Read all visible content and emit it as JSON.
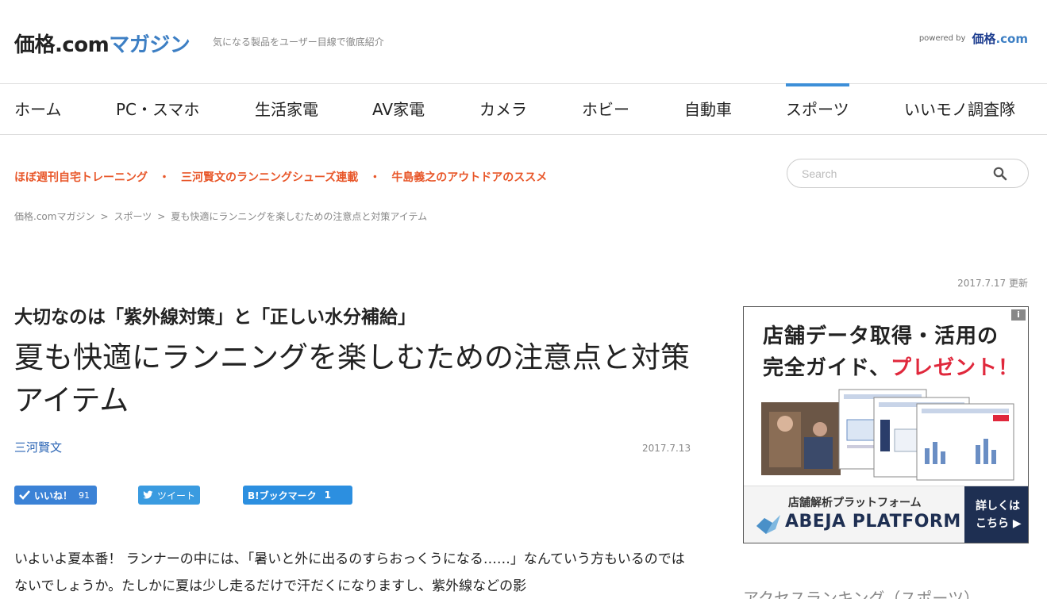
{
  "header": {
    "logo_part1": "価格.com",
    "logo_part2": "マガジン",
    "tagline": "気になる製品をユーザー目線で徹底紹介",
    "powered_by": "powered by",
    "powered_logo_part1": "価格",
    "powered_logo_part2": ".com"
  },
  "nav": {
    "items": [
      {
        "label": "ホーム"
      },
      {
        "label": "PC・スマホ"
      },
      {
        "label": "生活家電"
      },
      {
        "label": "AV家電"
      },
      {
        "label": "カメラ"
      },
      {
        "label": "ホビー"
      },
      {
        "label": "自動車"
      },
      {
        "label": "スポーツ",
        "active": true
      },
      {
        "label": "いいモノ調査隊"
      }
    ]
  },
  "subnav": {
    "links": [
      "ほぼ週刊自宅トレーニング",
      "三河賢文のランニングシューズ連載",
      "牛島義之のアウトドアのススメ"
    ],
    "separator": "・"
  },
  "search": {
    "placeholder": "Search"
  },
  "breadcrumb": {
    "items": [
      "価格.comマガジン",
      "スポーツ",
      "夏も快適にランニングを楽しむための注意点と対策アイテム"
    ],
    "separator": ">"
  },
  "updated": "2017.7.17 更新",
  "article": {
    "subtitle": "大切なのは「紫外線対策」と「正しい水分補給」",
    "title": "夏も快適にランニングを楽しむための注意点と対策アイテム",
    "author": "三河賢文",
    "date": "2017.7.13",
    "body": "いよいよ夏本番！ ランナーの中には、「暑いと外に出るのすらおっくうになる……」なんていう方もいるのではないでしょうか。たしかに夏は少し走るだけで汗だくになりますし、紫外線などの影"
  },
  "social": {
    "like_label": "いいね！",
    "like_count": "91",
    "tweet_label": "ツイート",
    "hatena_label": "B!ブックマーク",
    "hatena_count": "1"
  },
  "ad": {
    "info": "i",
    "headline1": "店舗データ取得・活用の",
    "headline2_a": "完全ガイド、",
    "headline2_b": "プレゼント！",
    "bottom_small": "店舗解析プラットフォーム",
    "bottom_brand": "ABEJA PLATFORM",
    "cta_line1": "詳しくは",
    "cta_line2": "こちら ▶",
    "accent_color": "#e0283c",
    "brand_color": "#1e2f52"
  },
  "sidebar": {
    "ranking_title": "アクセスランキング（スポーツ）"
  },
  "colors": {
    "accent_orange": "#e8572a",
    "nav_active": "#3d8fd8",
    "link_blue": "#2a64b4"
  }
}
